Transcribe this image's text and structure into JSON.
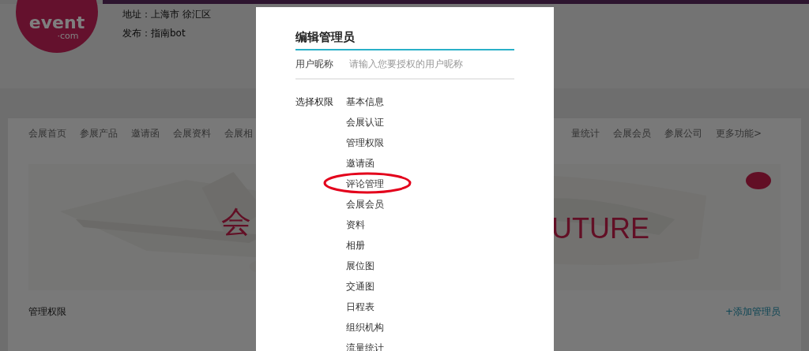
{
  "header": {
    "logo_text": "event",
    "logo_subtext": "·com",
    "address": "地址：上海市 徐汇区",
    "publisher": "发布：指南bot"
  },
  "nav": {
    "left": [
      "会展首页",
      "参展产品",
      "邀请函",
      "会展资料",
      "会展相"
    ],
    "right": [
      "量统计",
      "会展会员",
      "参展公司",
      "更多功能>"
    ]
  },
  "banner": {
    "text_left": "会",
    "text_right": "UTURE"
  },
  "section": {
    "title": "管理权限",
    "action": "+添加管理员"
  },
  "dialog": {
    "title": "编辑管理员",
    "nickname_label": "用户昵称",
    "nickname_placeholder": "请输入您要授权的用户昵称",
    "permissions_label": "选择权限",
    "permissions": [
      {
        "label": "基本信息",
        "highlighted": false
      },
      {
        "label": "会展认证",
        "highlighted": false
      },
      {
        "label": "管理权限",
        "highlighted": false
      },
      {
        "label": "邀请函",
        "highlighted": false
      },
      {
        "label": "评论管理",
        "highlighted": true
      },
      {
        "label": "会展会员",
        "highlighted": false
      },
      {
        "label": "资料",
        "highlighted": false
      },
      {
        "label": "相册",
        "highlighted": false
      },
      {
        "label": "展位图",
        "highlighted": false
      },
      {
        "label": "交通图",
        "highlighted": false
      },
      {
        "label": "日程表",
        "highlighted": false
      },
      {
        "label": "组织机构",
        "highlighted": false
      },
      {
        "label": "流量统计",
        "highlighted": false
      }
    ]
  }
}
